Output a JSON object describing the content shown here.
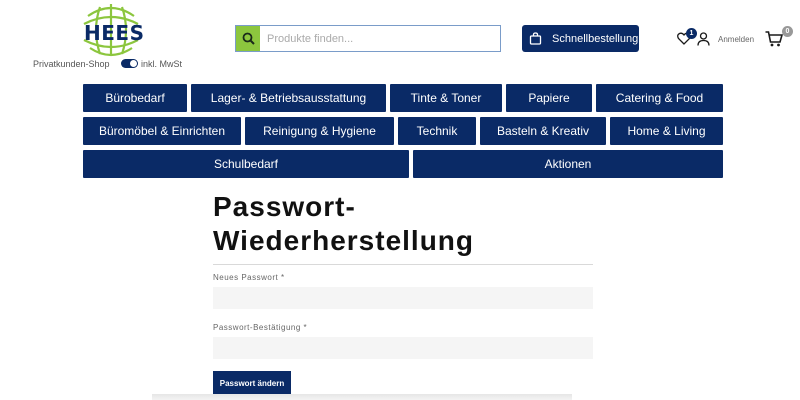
{
  "header": {
    "logo_text": "HEES",
    "shop_label": "Privatkunden-Shop",
    "vat_label": "inkl. MwSt",
    "search": {
      "placeholder": "Produkte finden..."
    },
    "quick_order_label": "Schnellbestellung",
    "wishlist_count": "1",
    "login_label": "Anmelden",
    "cart_count": "0",
    "brand_color": "#0a2a66",
    "accent_color": "#8cc63e"
  },
  "nav": {
    "row1": [
      "Bürobedarf",
      "Lager- & Betriebsausstattung",
      "Tinte & Toner",
      "Papiere",
      "Catering & Food"
    ],
    "row2": [
      "Büromöbel & Einrichten",
      "Reinigung & Hygiene",
      "Technik",
      "Basteln & Kreativ",
      "Home & Living"
    ],
    "row3": [
      "Schulbedarf",
      "Aktionen"
    ]
  },
  "form": {
    "title_line1": "Passwort-",
    "title_line2": "Wiederherstellung",
    "new_password_label": "Neues Passwort *",
    "confirm_label": "Passwort-Bestätigung *",
    "submit_label": "Passwort ändern"
  }
}
